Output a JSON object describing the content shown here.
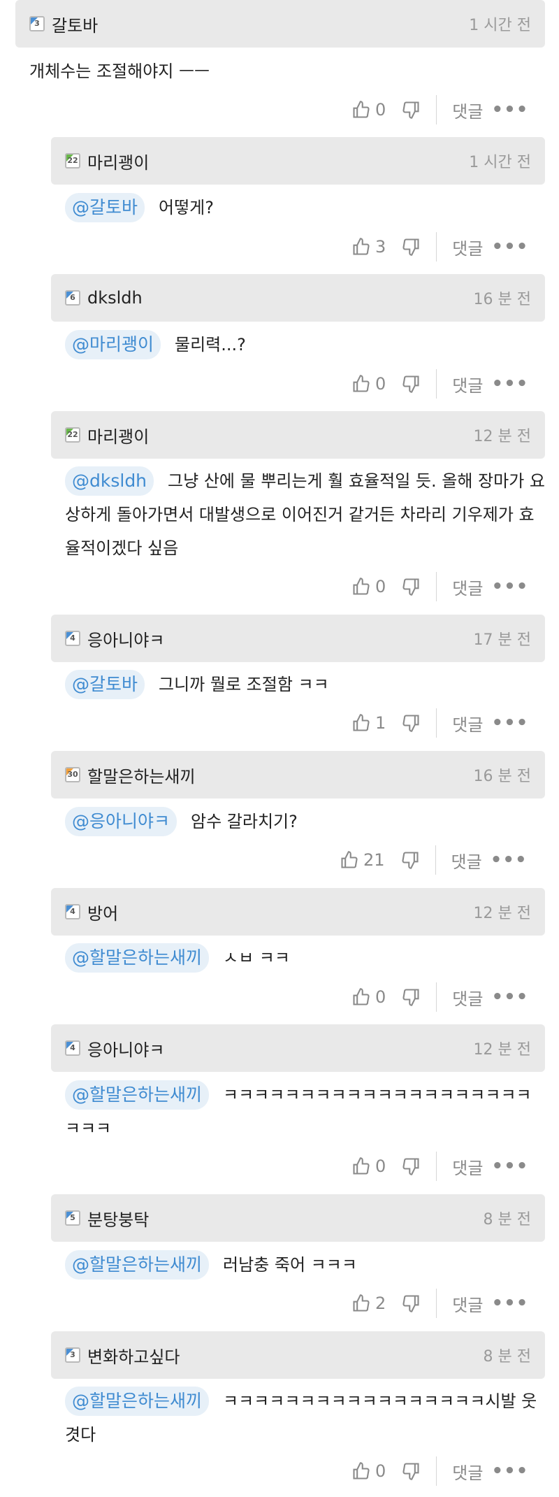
{
  "labels": {
    "reply": "댓글",
    "more": "•••"
  },
  "parent": {
    "user": "갈토바",
    "level": "3",
    "level_color": "blue",
    "time": "1 시간 전",
    "text": "개체수는 조절해야지 ㅡㅡ",
    "likes": "0"
  },
  "replies": [
    {
      "user": "마리괭이",
      "level": "22",
      "level_color": "green",
      "time": "1 시간 전",
      "mention": "@갈토바",
      "text": "어떻게?",
      "likes": "3"
    },
    {
      "user": "dksldh",
      "level": "6",
      "level_color": "blue",
      "time": "16 분 전",
      "mention": "@마리괭이",
      "text": "물리력...?",
      "likes": "0"
    },
    {
      "user": "마리괭이",
      "level": "22",
      "level_color": "green",
      "time": "12 분 전",
      "mention": "@dksldh",
      "text": "그냥 산에 물 뿌리는게 훨 효율적일 듯. 올해 장마가 요상하게 돌아가면서 대발생으로 이어진거 같거든 차라리 기우제가 효율적이겠다 싶음",
      "likes": "0"
    },
    {
      "user": "응아니야ㅋ",
      "level": "4",
      "level_color": "blue",
      "time": "17 분 전",
      "mention": "@갈토바",
      "text": "그니까 뭘로 조절함 ㅋㅋ",
      "likes": "1"
    },
    {
      "user": "할말은하는새끼",
      "level": "30",
      "level_color": "orange",
      "time": "16 분 전",
      "mention": "@응아니야ㅋ",
      "text": "암수 갈라치기?",
      "likes": "21"
    },
    {
      "user": "방어",
      "level": "4",
      "level_color": "blue",
      "time": "12 분 전",
      "mention": "@할말은하는새끼",
      "text": "ㅅㅂ ㅋㅋ",
      "likes": "0"
    },
    {
      "user": "응아니야ㅋ",
      "level": "4",
      "level_color": "blue",
      "time": "12 분 전",
      "mention": "@할말은하는새끼",
      "text": "ㅋㅋㅋㅋㅋㅋㅋㅋㅋㅋㅋㅋㅋㅋㅋㅋㅋㅋㅋㅋㅋㅋㅋ",
      "likes": "0"
    },
    {
      "user": "분탕붕탁",
      "level": "5",
      "level_color": "blue",
      "time": "8 분 전",
      "mention": "@할말은하는새끼",
      "text": "러남충 죽어 ㅋㅋㅋ",
      "likes": "2"
    },
    {
      "user": "변화하고싶다",
      "level": "3",
      "level_color": "blue",
      "time": "8 분 전",
      "mention": "@할말은하는새끼",
      "text": "ㅋㅋㅋㅋㅋㅋㅋㅋㅋㅋㅋㅋㅋㅋㅋㅋㅋ시발 웃겻다",
      "likes": "0"
    }
  ]
}
